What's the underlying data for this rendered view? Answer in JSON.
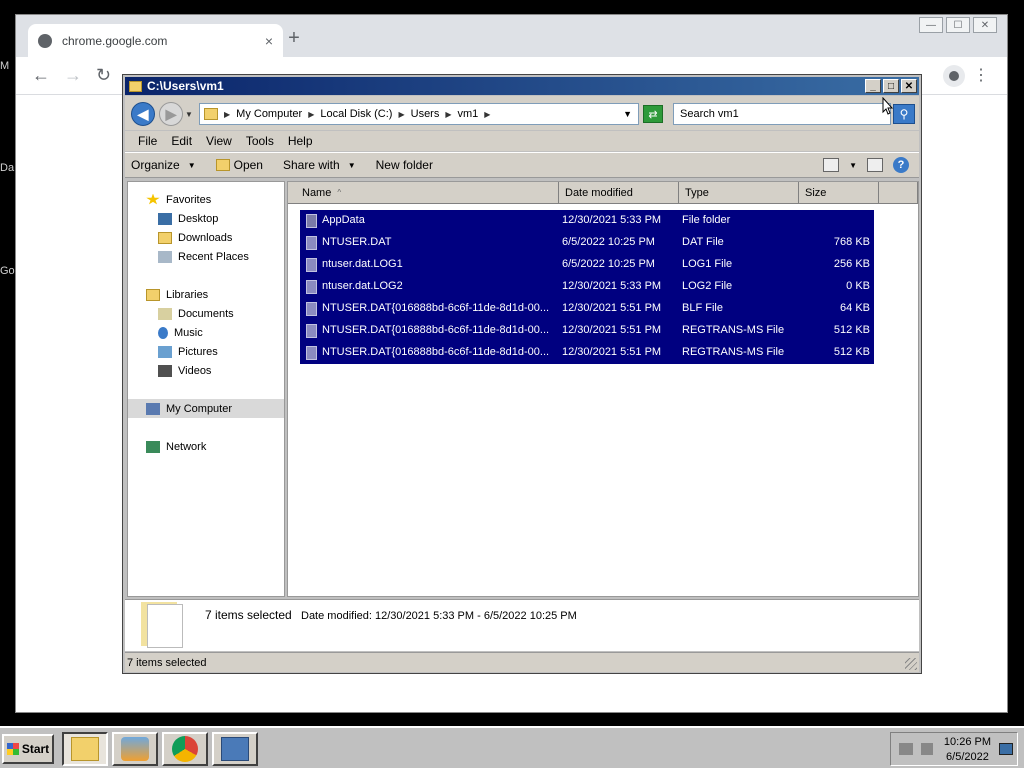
{
  "desktop": {
    "labels": [
      "M",
      "Da",
      "Go"
    ]
  },
  "chrome": {
    "tab_title": "chrome.google.com",
    "tab_close": "×",
    "new_tab": "+",
    "win_min": "—",
    "win_max": "☐",
    "win_close": "✕",
    "back": "←",
    "forward": "→",
    "reload": "↻",
    "menu": "⋮"
  },
  "explorer": {
    "title": "C:\\Users\\vm1",
    "title_btns": {
      "min": "_",
      "max": "□",
      "close": "✕"
    },
    "breadcrumb": [
      "My Computer",
      "Local Disk (C:)",
      "Users",
      "vm1"
    ],
    "search_placeholder": "Search vm1",
    "menu": [
      "File",
      "Edit",
      "View",
      "Tools",
      "Help"
    ],
    "commands": {
      "organize": "Organize",
      "open": "Open",
      "share": "Share with",
      "new_folder": "New folder",
      "help": "?"
    },
    "nav": {
      "favorites": "Favorites",
      "desktop": "Desktop",
      "downloads": "Downloads",
      "recent": "Recent Places",
      "libraries": "Libraries",
      "documents": "Documents",
      "music": "Music",
      "pictures": "Pictures",
      "videos": "Videos",
      "computer": "My Computer",
      "network": "Network"
    },
    "columns": {
      "name": "Name",
      "date": "Date modified",
      "type": "Type",
      "size": "Size"
    },
    "files": [
      {
        "name": "AppData",
        "date": "12/30/2021 5:33 PM",
        "type": "File folder",
        "size": ""
      },
      {
        "name": "NTUSER.DAT",
        "date": "6/5/2022 10:25 PM",
        "type": "DAT File",
        "size": "768 KB"
      },
      {
        "name": "ntuser.dat.LOG1",
        "date": "6/5/2022 10:25 PM",
        "type": "LOG1 File",
        "size": "256 KB"
      },
      {
        "name": "ntuser.dat.LOG2",
        "date": "12/30/2021 5:33 PM",
        "type": "LOG2 File",
        "size": "0 KB"
      },
      {
        "name": "NTUSER.DAT{016888bd-6c6f-11de-8d1d-00...",
        "date": "12/30/2021 5:51 PM",
        "type": "BLF File",
        "size": "64 KB"
      },
      {
        "name": "NTUSER.DAT{016888bd-6c6f-11de-8d1d-00...",
        "date": "12/30/2021 5:51 PM",
        "type": "REGTRANS-MS File",
        "size": "512 KB"
      },
      {
        "name": "NTUSER.DAT{016888bd-6c6f-11de-8d1d-00...",
        "date": "12/30/2021 5:51 PM",
        "type": "REGTRANS-MS File",
        "size": "512 KB"
      }
    ],
    "details": {
      "count": "7 items selected",
      "modified": "Date modified: 12/30/2021 5:33 PM - 6/5/2022 10:25 PM"
    },
    "status": "7 items selected"
  },
  "taskbar": {
    "start": "Start",
    "time": "10:26 PM",
    "date": "6/5/2022"
  },
  "colors": {
    "selection": "#000080",
    "title_bar": "#0a246a",
    "taskbar": "#c0c0c0"
  }
}
